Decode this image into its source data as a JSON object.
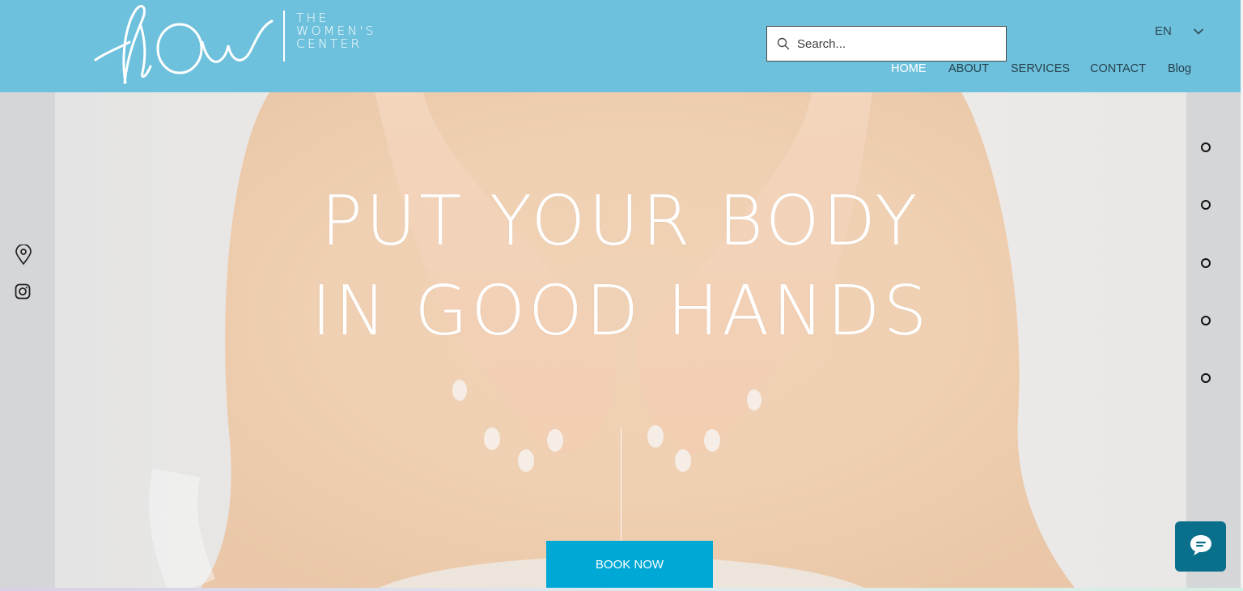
{
  "brand": {
    "logo_script": "flOw",
    "logo_lines": [
      "THE",
      "WOMEN'S",
      "CENTER"
    ]
  },
  "search": {
    "placeholder": "Search...",
    "value": ""
  },
  "language": {
    "label": "EN"
  },
  "nav": {
    "items": [
      {
        "label": "HOME",
        "active": true
      },
      {
        "label": "ABOUT",
        "active": false
      },
      {
        "label": "SERVICES",
        "active": false
      },
      {
        "label": "CONTACT",
        "active": false
      },
      {
        "label": "Blog",
        "active": false
      }
    ]
  },
  "social": {
    "icons": [
      "location-pin-icon",
      "instagram-icon"
    ]
  },
  "hero": {
    "title_line1": "PUT YOUR BODY",
    "title_line2": "IN GOOD HANDS",
    "cta_label": "BOOK NOW"
  },
  "section_nav": {
    "dot_count": 5
  },
  "colors": {
    "header_bg": "#6ec1dc",
    "accent": "#00a8d6",
    "chat_button": "#0a6f8b"
  }
}
